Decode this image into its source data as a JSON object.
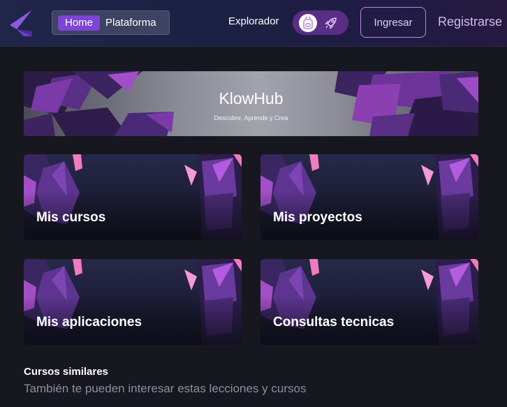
{
  "nav": {
    "home_label": "Home",
    "platform_label": "Plataforma",
    "explorer_label": "Explorador",
    "login_label": "Ingresar",
    "register_label": "Registrarse",
    "icons": [
      "logo-icon",
      "backpack-icon",
      "rocket-icon"
    ]
  },
  "hero": {
    "title": "KlowHub",
    "subtitle": "Descubre, Aprende y Crea"
  },
  "cards": [
    {
      "label": "Mis cursos"
    },
    {
      "label": "Mis proyectos"
    },
    {
      "label": "Mis aplicaciones"
    },
    {
      "label": "Consultas tecnicas"
    }
  ],
  "section": {
    "title": "Cursos similares",
    "subtitle": "También te pueden interesar estas lecciones y cursos"
  },
  "colors": {
    "accent": "#7c45d6",
    "toggle": "#5a2e84",
    "background": "#16171f",
    "muted_text": "#8d8f9f"
  }
}
